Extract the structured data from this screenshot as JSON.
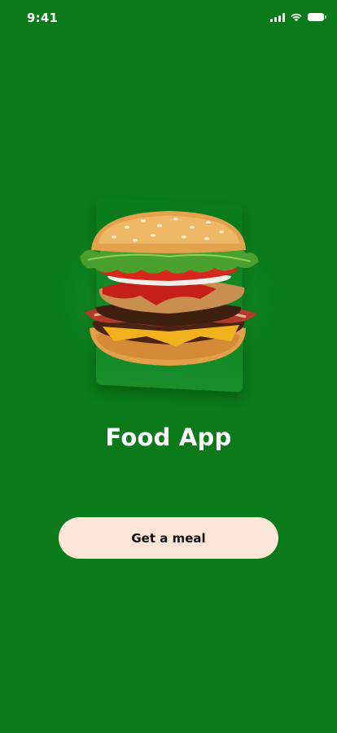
{
  "status_bar": {
    "time": "9:41",
    "icons": [
      "signal-icon",
      "wifi-icon",
      "battery-icon"
    ]
  },
  "hero": {
    "image": "burger-image"
  },
  "title": "Food App",
  "cta": {
    "label": "Get a meal"
  },
  "colors": {
    "background": "#0a7a1a",
    "button_bg": "#fde6d8",
    "title_text": "#ffffff",
    "button_text": "#111111"
  }
}
